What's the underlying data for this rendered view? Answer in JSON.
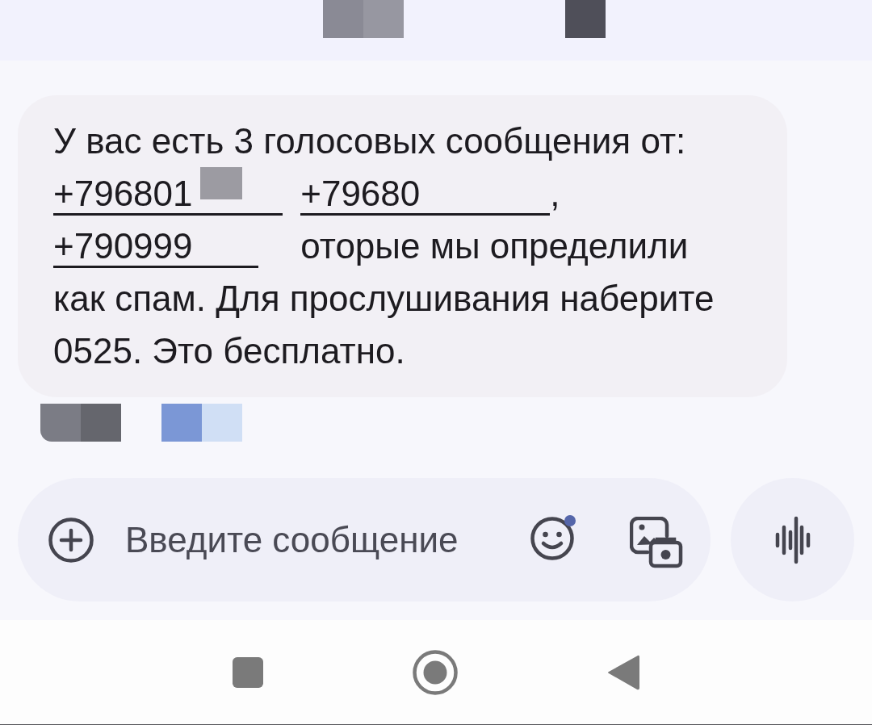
{
  "message": {
    "parts": [
      {
        "kind": "text",
        "text": "У вас есть 3 голосовых сообщения от:"
      },
      {
        "kind": "link",
        "text": "+796801"
      },
      {
        "kind": "link",
        "text": "+79680"
      },
      {
        "kind": "punct",
        "text": ","
      },
      {
        "kind": "link",
        "text": "+790999"
      },
      {
        "kind": "text",
        "text": "оторые мы определили как спам. Для прослушивания наберите 0525. Это бесплатно."
      }
    ]
  },
  "composer": {
    "placeholder": "Введите сообщение",
    "emoji_badge": true
  }
}
